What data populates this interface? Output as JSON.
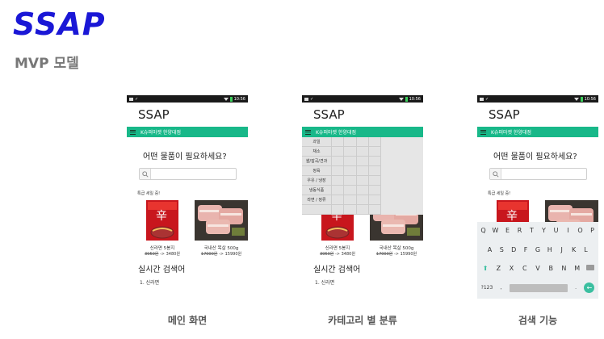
{
  "slide": {
    "logo": "SSAP",
    "subtitle": "MVP 모델",
    "captions": [
      "메인 화면",
      "카테고리 별 분류",
      "검색 기능"
    ]
  },
  "phone": {
    "status_time": "10:56",
    "app_title": "SSAP",
    "market": "K슈퍼마켓 한양대점",
    "question": "어떤 물품이 필요하세요?",
    "search_placeholder": "",
    "sale_label": "특급 세일 중!",
    "products": [
      {
        "name": "신라면 5봉지",
        "old_price": "3950원",
        "new_price": "3480원"
      },
      {
        "name": "국내산 목살 500g",
        "old_price": "17000원",
        "new_price": "15990원"
      }
    ],
    "realtime_title": "실시간 검색어",
    "realtime_items": [
      "1. 신라면"
    ]
  },
  "categories": [
    "과일",
    "채소",
    "쌀/잡곡/견과",
    "정육",
    "우유 / 냉장",
    "냉동식품",
    "라면 / 정류"
  ],
  "keyboard": {
    "row1": [
      "Q",
      "W",
      "E",
      "R",
      "T",
      "Y",
      "U",
      "I",
      "O",
      "P"
    ],
    "row2": [
      "A",
      "S",
      "D",
      "F",
      "G",
      "H",
      "J",
      "K",
      "L"
    ],
    "row3": [
      "Z",
      "X",
      "C",
      "V",
      "B",
      "N",
      "M"
    ],
    "row4_left": "?123",
    "row4_comma": ",",
    "row4_period": "."
  },
  "colors": {
    "brand": "#1a17d6",
    "accent": "#18b889"
  }
}
